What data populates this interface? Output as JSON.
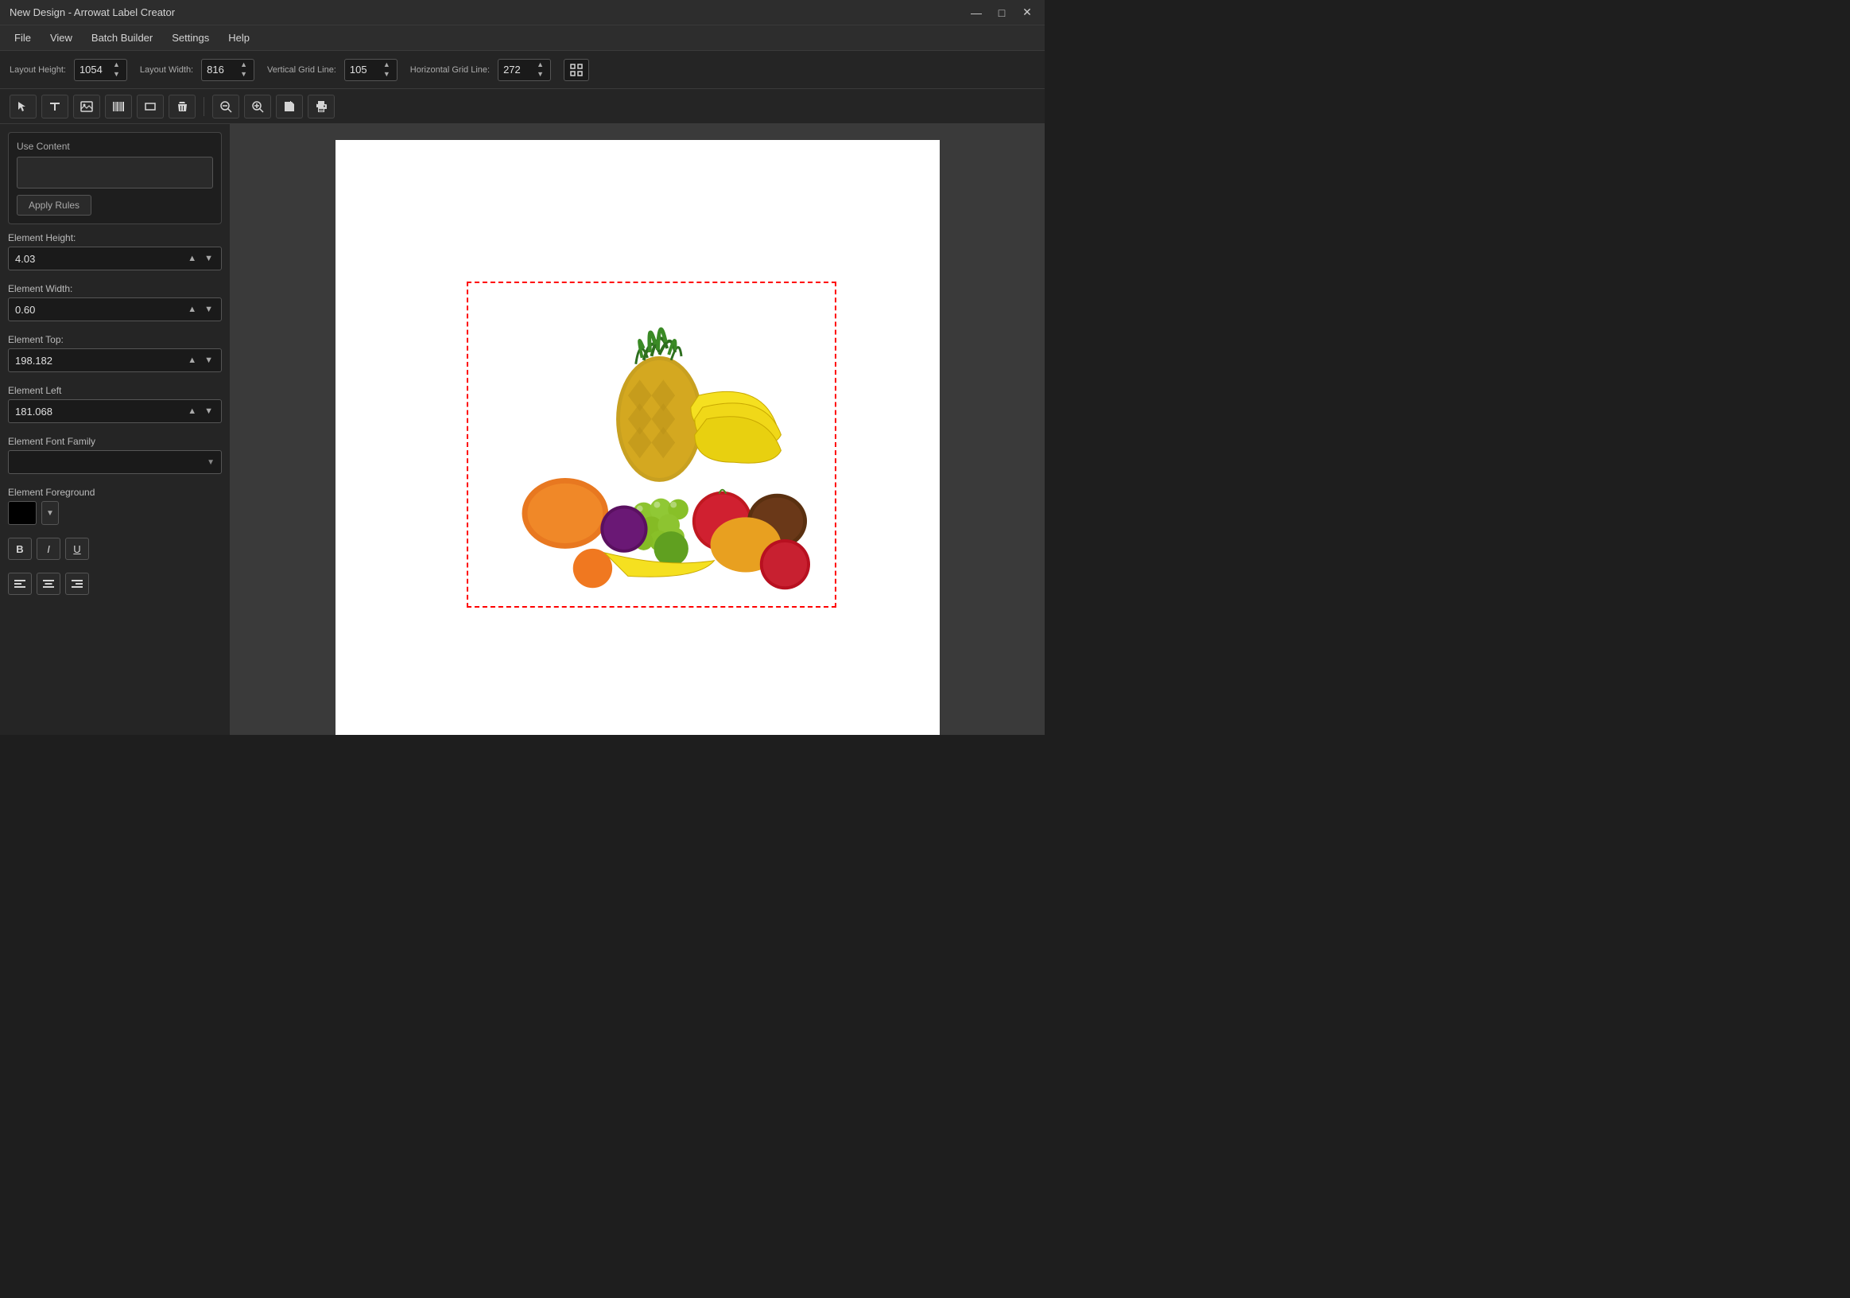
{
  "titlebar": {
    "title": "New Design - Arrowat Label Creator",
    "minimize": "—",
    "maximize": "□",
    "close": "✕"
  },
  "menubar": {
    "items": [
      "File",
      "View",
      "Batch Builder",
      "Settings",
      "Help"
    ]
  },
  "toolbar": {
    "layout_height_label": "Layout Height:",
    "layout_height_value": "1054",
    "layout_width_label": "Layout Width:",
    "layout_width_value": "816",
    "vertical_grid_label": "Vertical Grid Line:",
    "vertical_grid_value": "105",
    "horizontal_grid_label": "Horizontal Grid Line:",
    "horizontal_grid_value": "272"
  },
  "left_panel": {
    "use_content_label": "Use Content",
    "apply_rules_label": "Apply Rules",
    "element_height_label": "Element Height:",
    "element_height_value": "4.03",
    "element_width_label": "Element Width:",
    "element_width_value": "0.60",
    "element_top_label": "Element Top:",
    "element_top_value": "198.182",
    "element_left_label": "Element Left",
    "element_left_value": "181.068",
    "element_font_family_label": "Element Font Family",
    "element_font_family_placeholder": "",
    "element_foreground_label": "Element Foreground",
    "foreground_color": "#000000"
  },
  "tools": {
    "pointer": "↖",
    "text": "T",
    "image": "🖼",
    "barcode": "▥",
    "rectangle": "▭",
    "delete": "🗑",
    "separator": "",
    "zoom_out": "−",
    "zoom_in": "+",
    "save": "💾",
    "print": "🖨"
  }
}
